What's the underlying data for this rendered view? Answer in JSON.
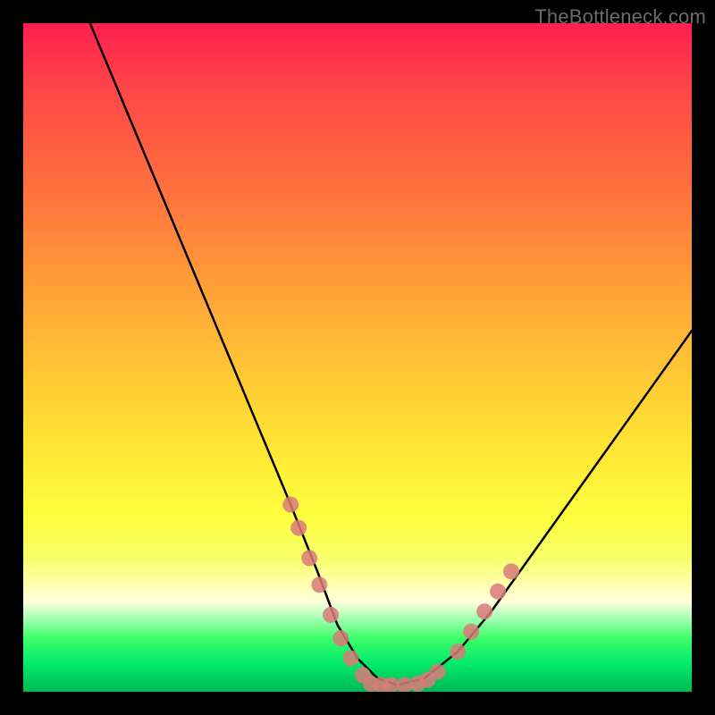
{
  "watermark": "TheBottleneck.com",
  "chart_data": {
    "type": "line",
    "title": "",
    "xlabel": "",
    "ylabel": "",
    "xlim": [
      0,
      100
    ],
    "ylim": [
      0,
      100
    ],
    "grid": false,
    "series": [
      {
        "name": "bottleneck-curve",
        "color": "#000000",
        "x": [
          10,
          15,
          20,
          25,
          30,
          35,
          40,
          44,
          47,
          50,
          53,
          56,
          60,
          65,
          70,
          75,
          80,
          85,
          90,
          95,
          100
        ],
        "y": [
          100,
          88,
          76,
          64,
          52,
          40,
          28,
          18,
          10,
          5,
          2,
          1,
          2,
          6,
          12,
          19,
          26,
          33,
          40,
          47,
          54
        ]
      }
    ],
    "marker_clusters": [
      {
        "name": "left-cluster",
        "color": "#d97a7a",
        "x": [
          40.0,
          41.2,
          42.8,
          44.3,
          46.0,
          47.5,
          49.0,
          50.8
        ],
        "y": [
          28.0,
          24.5,
          20.0,
          16.0,
          11.5,
          8.0,
          5.0,
          2.5
        ]
      },
      {
        "name": "bottom-cluster",
        "color": "#d97a7a",
        "x": [
          52.0,
          53.5,
          55.0,
          57.0,
          59.0,
          60.5,
          62.0
        ],
        "y": [
          1.2,
          1.0,
          1.0,
          1.0,
          1.2,
          1.8,
          3.0
        ]
      },
      {
        "name": "right-cluster",
        "color": "#d97a7a",
        "x": [
          65.0,
          67.0,
          69.0,
          71.0,
          73.0
        ],
        "y": [
          6.0,
          9.0,
          12.0,
          15.0,
          18.0
        ]
      }
    ],
    "background_gradient": {
      "top": "#ff1f4f",
      "mid": "#ffe233",
      "bottom": "#00b853"
    }
  }
}
